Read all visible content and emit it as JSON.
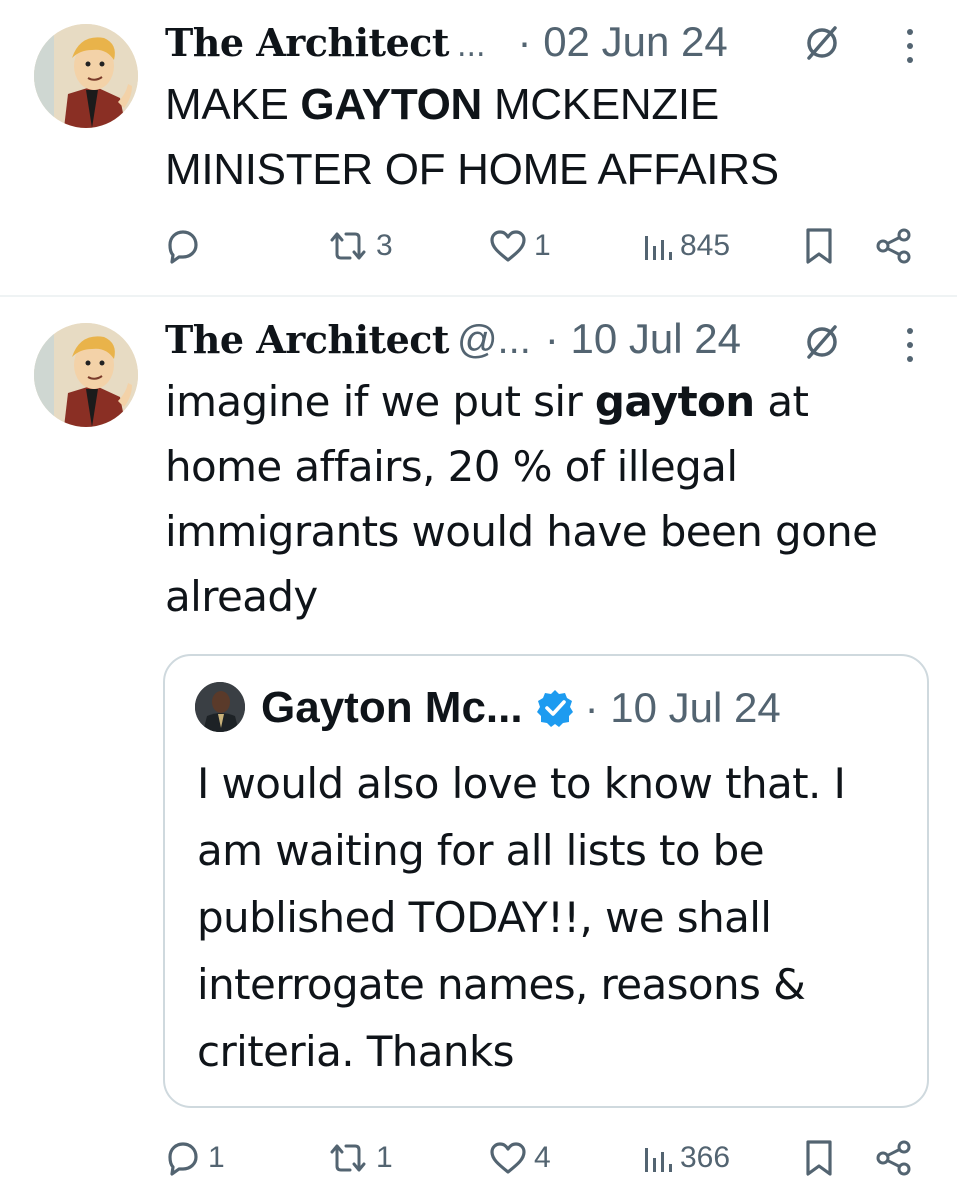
{
  "tweets": [
    {
      "display_name": "The Architect",
      "name_ellipsis": "...",
      "handle": "",
      "separator_date": "· 02 Jun 24",
      "text_parts": [
        "MAKE ",
        "GAYTON",
        " MCKENZIE MINISTER OF HOME AFFAIRS"
      ],
      "actions": {
        "replies": "",
        "reposts": "3",
        "likes": "1",
        "views": "845"
      }
    },
    {
      "display_name": "The Architect",
      "handle": "@...",
      "separator_date": "· 10 Jul 24",
      "text_parts": [
        "imagine if we put sir ",
        "gayton",
        " at home affairs, 20 % of illegal immigrants would have been gone already"
      ],
      "actions": {
        "replies": "1",
        "reposts": "1",
        "likes": "4",
        "views": "366"
      },
      "quote": {
        "name": "Gayton Mc...",
        "separator_date": "· 10 Jul 24",
        "text": "I would also love to know that. I am waiting for all lists to be published TODAY!!, we shall interrogate names, reasons & criteria. Thanks"
      }
    }
  ],
  "colors": {
    "text": "#0f1419",
    "secondary": "#536471",
    "divider": "#eff3f4",
    "verified": "#1d9bf0",
    "quote_border": "#cfd9de"
  },
  "icons": [
    "reply-icon",
    "repost-icon",
    "like-icon",
    "views-icon",
    "bookmark-icon",
    "share-icon",
    "mute-icon",
    "more-icon",
    "verified-badge-icon"
  ]
}
